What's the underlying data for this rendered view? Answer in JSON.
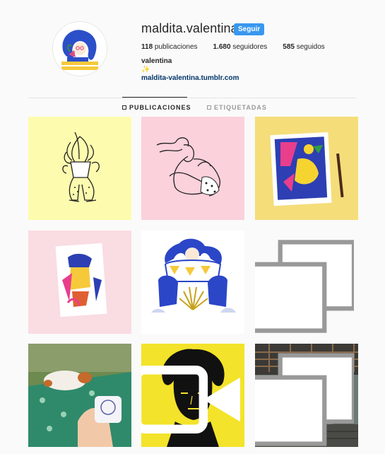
{
  "profile": {
    "username": "maldita.valentina",
    "follow_label": "Seguir",
    "posts_count": "118",
    "posts_label": "publicaciones",
    "followers_count": "1.680",
    "followers_label": "seguidores",
    "following_count": "585",
    "following_label": "seguidos",
    "full_name": "valentina",
    "bio_emoji": "✨",
    "website": "maldita-valentina.tumblr.com"
  },
  "tabs": [
    {
      "label": "PUBLICACIONES",
      "active": true,
      "icon": "grid-icon"
    },
    {
      "label": "ETIQUETADAS",
      "active": false,
      "icon": "tag-icon"
    }
  ],
  "posts": [
    {
      "name": "post-plant-illustration",
      "bg": "#fdfcae"
    },
    {
      "name": "post-hug-illustration",
      "bg": "#fbd1db"
    },
    {
      "name": "post-print-on-yellow",
      "bg": "#f5dd7a"
    },
    {
      "name": "post-print-on-pink",
      "bg": "#fadce3"
    },
    {
      "name": "post-squatting-woman",
      "bg": "#ffffff"
    },
    {
      "name": "post-bald-man-sketch",
      "bg": "#fafafa",
      "badge": "multiple-icon"
    },
    {
      "name": "post-dog-sticker-photo",
      "bg": "#6d8a4f"
    },
    {
      "name": "post-afro-portrait",
      "bg": "#f3e32a",
      "badge": "video-icon"
    },
    {
      "name": "post-pergola-photo",
      "bg": "#3b3a36",
      "badge": "multiple-icon"
    }
  ]
}
